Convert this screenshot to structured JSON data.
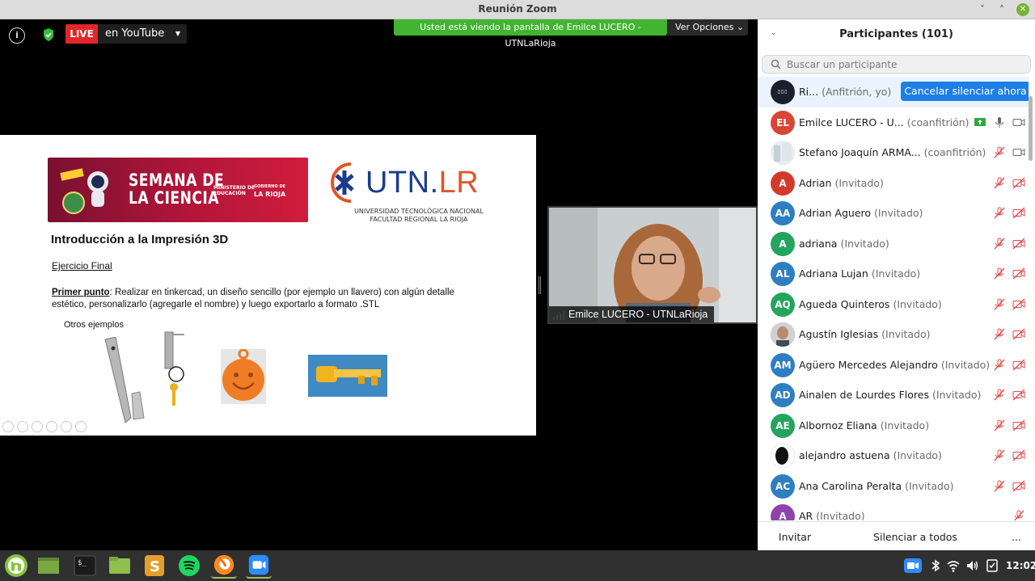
{
  "window": {
    "title": "Reunión Zoom",
    "minimize": "ˇ",
    "maximize": "˄",
    "close": "✕"
  },
  "meeting": {
    "info_icon": "info-icon",
    "live_badge": "LIVE",
    "live_destination": "en YouTube",
    "share_banner": "Usted está viendo la pantalla de Emilce LUCERO - UTNLaRioja",
    "view_options": "Ver Opciones ⌄"
  },
  "slide": {
    "banner_title_1": "SEMANA DE",
    "banner_title_2": "LA CIENCIA",
    "banner_ministry_1": "MINISTERIO DE",
    "banner_ministry_2": "EDUCACIÓN",
    "banner_gov_1": "GOBIERNO DE",
    "banner_gov_2": "LA RIOJA",
    "utn_logo_main": "UTN.",
    "utn_logo_suffix": "LR",
    "utn_sub_1": "UNIVERSIDAD TECNOLÓGICA NACIONAL",
    "utn_sub_2": "FACULTAD REGIONAL LA RIOJA",
    "title": "Introducción a la Impresión 3D",
    "subtitle": "Ejercicio Final",
    "point_label": "Primer punto",
    "point_text": ":  Realizar en tinkercad, un diseño sencillo (por ejemplo un llavero) con algún detalle estético, personalizarlo (agregarle el nombre) y luego exportarlo a formato  .STL",
    "examples_label": "Otros ejemplos"
  },
  "video": {
    "name": "Emilce LUCERO - UTNLaRioja"
  },
  "participants": {
    "title": "Participantes (101)",
    "search_placeholder": "Buscar un participante",
    "cancel_mute_label": "Cancelar silenciar ahora",
    "rows": [
      {
        "initials": "",
        "name": "Ri...",
        "role": "(Anfitrión, yo)",
        "color": "#1a1f2e"
      },
      {
        "initials": "EL",
        "name": "Emilce LUCERO - U...",
        "role": "(coanfitrión)",
        "color": "#d94535"
      },
      {
        "initials": "",
        "name": "Stefano Joaquín ARMA...",
        "role": "(coanfitrión)",
        "color": "#e9ecef"
      },
      {
        "initials": "A",
        "name": "Adrian",
        "role": "(Invitado)",
        "color": "#d23b2c"
      },
      {
        "initials": "AA",
        "name": "Adrian Aguero",
        "role": "(Invitado)",
        "color": "#2e7ec1"
      },
      {
        "initials": "A",
        "name": "adriana",
        "role": "(Invitado)",
        "color": "#23a45f"
      },
      {
        "initials": "AL",
        "name": "Adriana Lujan",
        "role": "(Invitado)",
        "color": "#2e7ec1"
      },
      {
        "initials": "AQ",
        "name": "Agueda Quinteros",
        "role": "(Invitado)",
        "color": "#23a45f"
      },
      {
        "initials": "",
        "name": "Agustín Iglesias",
        "role": "(Invitado)",
        "color": "#7a6a5e"
      },
      {
        "initials": "AM",
        "name": "Agüero Mercedes Alejandro",
        "role": "(Invitado)",
        "color": "#2e7ec1"
      },
      {
        "initials": "AD",
        "name": "Ainalen de Lourdes Flores",
        "role": "(Invitado)",
        "color": "#2e7ec1"
      },
      {
        "initials": "AE",
        "name": "Albornoz Eliana",
        "role": "(Invitado)",
        "color": "#23a45f"
      },
      {
        "initials": "",
        "name": "alejandro astuena",
        "role": "(Invitado)",
        "color": "#111111"
      },
      {
        "initials": "AC",
        "name": "Ana Carolina Peralta",
        "role": "(Invitado)",
        "color": "#2e7ec1"
      },
      {
        "initials": "A",
        "name": "AR",
        "role": "(Invitado)",
        "color": "#8e44ad"
      }
    ],
    "invite_label": "Invitar",
    "mute_all_label": "Silenciar a todos",
    "more_label": "..."
  },
  "taskbar": {
    "time": "12:02"
  }
}
